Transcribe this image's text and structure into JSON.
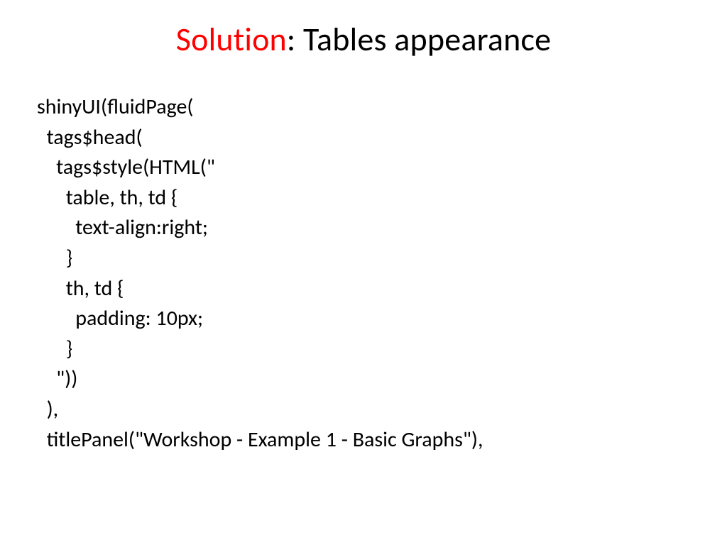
{
  "title": {
    "accent": "Solution",
    "rest": ": Tables appearance"
  },
  "code": {
    "l1": "shinyUI(fluidPage(",
    "l2": "  tags$head(",
    "l3": "    tags$style(HTML(\"",
    "l4": "      table, th, td {",
    "l5": "        text-align:right;",
    "l6": "      }",
    "l7": "      th, td {",
    "l8": "        padding: 10px;",
    "l9": "      }",
    "l10": "    \"))",
    "l11": "  ),",
    "l12": "  titlePanel(\"Workshop - Example 1 - Basic Graphs\"),"
  }
}
